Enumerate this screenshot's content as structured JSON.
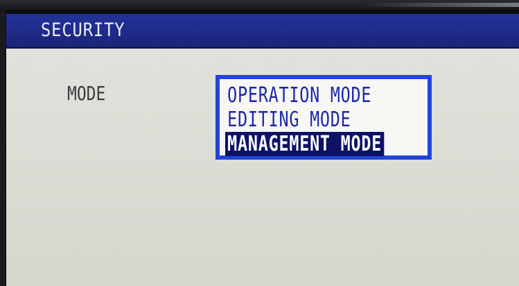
{
  "screen": {
    "title": "SECURITY"
  },
  "form": {
    "mode_label": "MODE",
    "options": [
      {
        "label": "OPERATION MODE",
        "selected": false
      },
      {
        "label": "EDITING MODE",
        "selected": false
      },
      {
        "label": "MANAGEMENT MODE",
        "selected": true
      }
    ]
  },
  "colors": {
    "title_bar": "#1f2c8a",
    "selection_box_border": "#2443d8",
    "option_text": "#1d27a8",
    "selected_highlight": "#0e1266",
    "panel_background": "#e1e2da"
  }
}
